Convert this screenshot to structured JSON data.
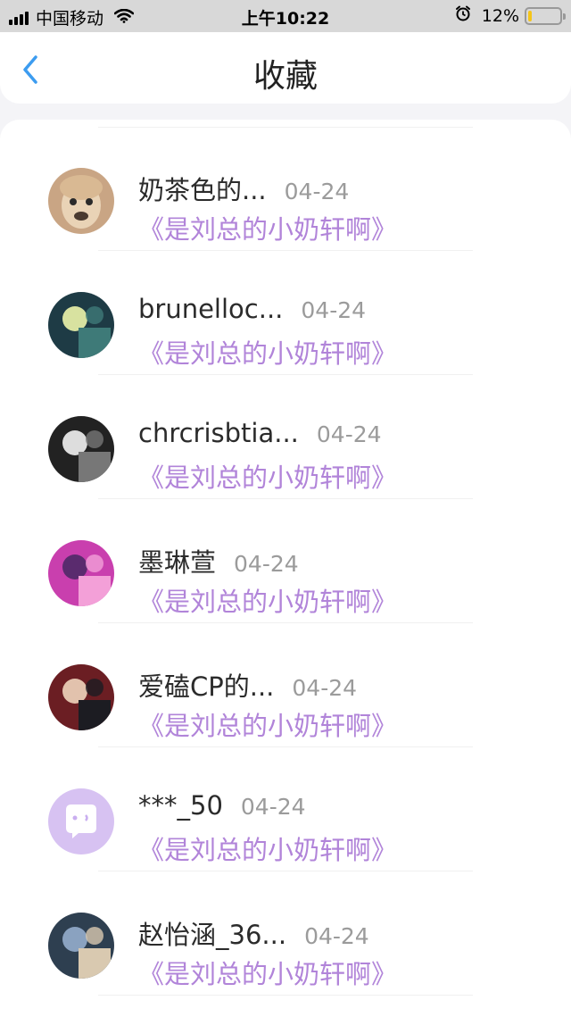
{
  "status_bar": {
    "carrier": "中国移动",
    "time": "上午10:22",
    "battery_text": "12%",
    "battery_level": 0.12,
    "battery_color": "#f5c518"
  },
  "nav": {
    "back_icon": "chevron-left-icon",
    "title": "收藏"
  },
  "colors": {
    "accent": "#3c9cf0",
    "link_purple": "#b184d9",
    "date_gray": "#9b9b9b"
  },
  "favorites": [
    {
      "name": "奶茶色的...",
      "date": "04-24",
      "link": "《是刘总的小奶轩啊》",
      "avatar": "alpaca-avatar"
    },
    {
      "name": "brunelloc...",
      "date": "04-24",
      "link": "《是刘总的小奶轩啊》",
      "avatar": "user-avatar"
    },
    {
      "name": "chrcrisbtia...",
      "date": "04-24",
      "link": "《是刘总的小奶轩啊》",
      "avatar": "user-avatar"
    },
    {
      "name": "墨琳萱",
      "date": "04-24",
      "link": "《是刘总的小奶轩啊》",
      "avatar": "user-avatar"
    },
    {
      "name": "爱磕CP的...",
      "date": "04-24",
      "link": "《是刘总的小奶轩啊》",
      "avatar": "user-avatar"
    },
    {
      "name": "***_50",
      "date": "04-24",
      "link": "《是刘总的小奶轩啊》",
      "avatar": "default-chat-avatar"
    },
    {
      "name": "赵怡涵_36...",
      "date": "04-24",
      "link": "《是刘总的小奶轩啊》",
      "avatar": "user-avatar"
    }
  ]
}
